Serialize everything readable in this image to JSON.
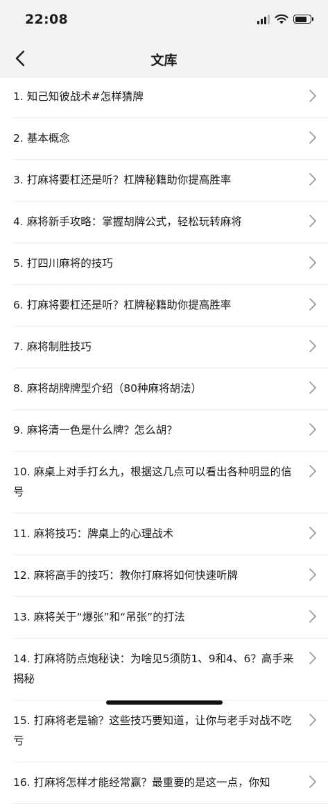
{
  "status": {
    "time": "22:08",
    "battery_level": 0.8
  },
  "nav": {
    "title": "文库"
  },
  "icons": {
    "back": "chevron-left-icon",
    "row": "chevron-right-icon"
  },
  "items": [
    "1. 知己知彼战术#怎样猜牌",
    "2. 基本概念",
    "3. 打麻将要杠还是听？杠牌秘籍助你提高胜率",
    "4. 麻将新手攻略：掌握胡牌公式，轻松玩转麻将",
    "5. 打四川麻将的技巧",
    "6. 打麻将要杠还是听？杠牌秘籍助你提高胜率",
    "7. 麻将制胜技巧",
    "8. 麻将胡牌牌型介绍（80种麻将胡法）",
    "9. 麻将清一色是什么牌？怎么胡？",
    "10. 麻桌上对手打幺九，根据这几点可以看出各种明显的信号",
    "11. 麻将技巧：牌桌上的心理战术",
    "12. 麻将高手的技巧：教你打麻将如何快速听牌",
    "13. 麻将关于“爆张”和“吊张”的打法",
    "14. 打麻将防点炮秘诀：为啥见5须防1、9和4、6？高手来揭秘",
    "15. 打麻将老是输？这些技巧要知道，让你与老手对战不吃亏",
    "16. 打麻将怎样才能经常赢？最重要的是这一点，你知"
  ]
}
